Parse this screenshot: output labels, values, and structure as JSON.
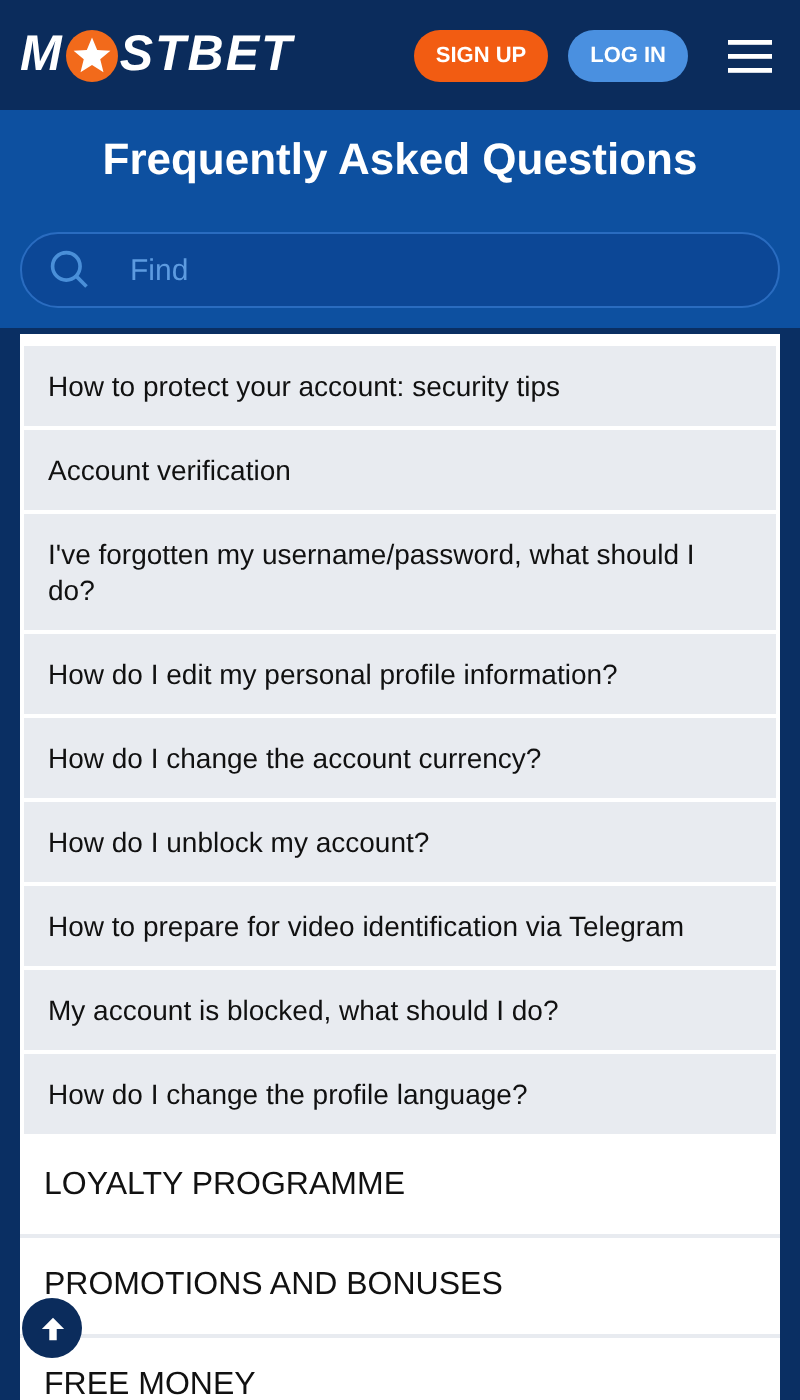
{
  "header": {
    "logo": {
      "before": "M",
      "after": "STBET"
    },
    "buttons": [
      {
        "kind": "signup",
        "label": "SIGN UP"
      },
      {
        "kind": "login",
        "label": "LOG IN"
      }
    ]
  },
  "title": "Frequently Asked Questions",
  "search": {
    "placeholder": "Find"
  },
  "questions": [
    "How to protect your account: security tips",
    "Account verification",
    "I've forgotten my username/password, what should I do?",
    "How do I edit my personal profile information?",
    "How do I change the account currency?",
    "How do I unblock my account?",
    "How to prepare for video identification via Telegram",
    "My account is blocked, what should I do?",
    "How do I change the profile language?"
  ],
  "sections": [
    "LOYALTY PROGRAMME",
    "PROMOTIONS AND BONUSES",
    "FREE MONEY"
  ]
}
